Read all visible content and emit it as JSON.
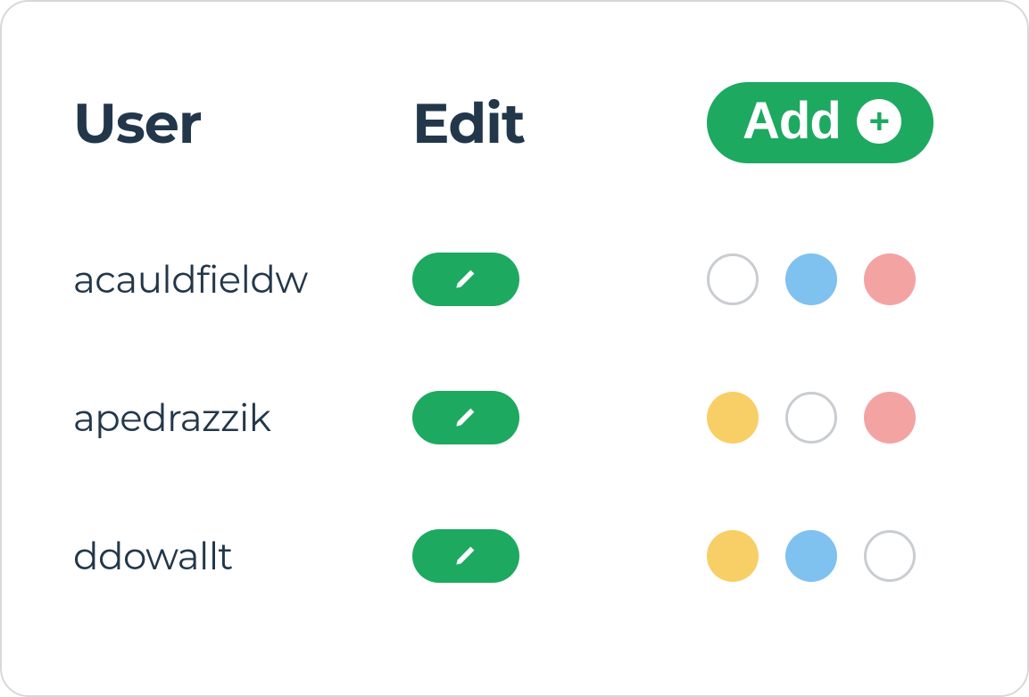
{
  "headers": {
    "user": "User",
    "edit": "Edit",
    "add_label": "Add"
  },
  "colors": {
    "green": "#1da960",
    "yellow": "#f8cf66",
    "blue": "#7fc1ef",
    "red": "#f4a3a3",
    "empty_border": "#c9cdd1",
    "text": "#22374a"
  },
  "rows": [
    {
      "username": "acauldfieldw",
      "dots": [
        "empty",
        "blue",
        "red"
      ]
    },
    {
      "username": "apedrazzik",
      "dots": [
        "yellow",
        "empty",
        "red"
      ]
    },
    {
      "username": "ddowallt",
      "dots": [
        "yellow",
        "blue",
        "empty"
      ]
    }
  ]
}
